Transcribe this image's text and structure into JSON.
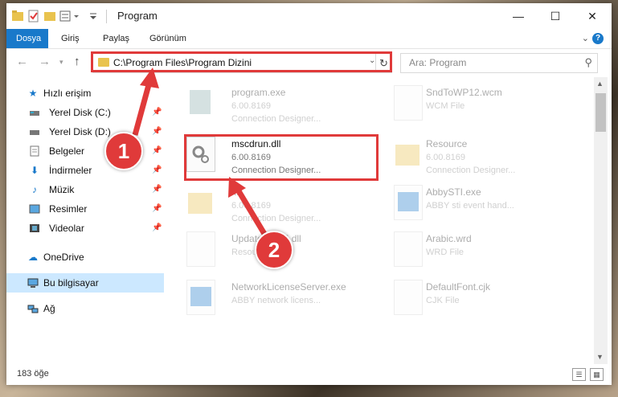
{
  "window": {
    "title": "Program",
    "controls": {
      "minimize": "—",
      "maximize": "☐",
      "close": "✕"
    }
  },
  "ribbon": {
    "tabs": [
      {
        "label": "Dosya",
        "active": true
      },
      {
        "label": "Giriş"
      },
      {
        "label": "Paylaş"
      },
      {
        "label": "Görünüm"
      }
    ],
    "help": "?"
  },
  "nav": {
    "address": "C:\\Program Files\\Program Dizini",
    "search_placeholder": "Ara: Program"
  },
  "sidebar": {
    "items": [
      {
        "label": "Hızlı erişim",
        "icon": "star-icon",
        "pinned": false
      },
      {
        "label": "Yerel Disk (C:)",
        "icon": "drive-icon",
        "pinned": true
      },
      {
        "label": "Yerel Disk (D:)",
        "icon": "drive-icon",
        "pinned": true
      },
      {
        "label": "Belgeler",
        "icon": "documents-icon",
        "pinned": true
      },
      {
        "label": "İndirmeler",
        "icon": "download-icon",
        "pinned": true
      },
      {
        "label": "Müzik",
        "icon": "music-icon",
        "pinned": true
      },
      {
        "label": "Resimler",
        "icon": "pictures-icon",
        "pinned": true
      },
      {
        "label": "Videolar",
        "icon": "video-icon",
        "pinned": true
      },
      {
        "label": "OneDrive",
        "icon": "cloud-icon"
      },
      {
        "label": "Bu bilgisayar",
        "icon": "computer-icon",
        "selected": true
      },
      {
        "label": "Ağ",
        "icon": "network-icon"
      }
    ]
  },
  "files": [
    {
      "name": "program.exe",
      "version": "6.00.8169",
      "desc": "Connection Designer...",
      "dim": true
    },
    {
      "name": "SndToWP12.wcm",
      "version": "WCM File",
      "desc": "",
      "dim": true
    },
    {
      "name": "mscdrun.dll",
      "version": "6.00.8169",
      "desc": "Connection Designer...",
      "dim": false
    },
    {
      "name": "Resource",
      "version": "6.00.8169",
      "desc": "Connection Designer...",
      "dim": true
    },
    {
      "name": "xtr",
      "version": "6.00.8169",
      "desc": "Connection Designer...",
      "dim": true
    },
    {
      "name": "AbbySTI.exe",
      "version": "ABBY sti event hand...",
      "desc": "",
      "dim": true
    },
    {
      "name": "Updatestat65.dll",
      "version": "Resource",
      "desc": "",
      "dim": true
    },
    {
      "name": "Arabic.wrd",
      "version": "WRD File",
      "desc": "",
      "dim": true
    },
    {
      "name": "NetworkLicenseServer.exe",
      "version": "ABBY network licens...",
      "desc": "",
      "dim": true
    },
    {
      "name": "DefaultFont.cjk",
      "version": "CJK File",
      "desc": "",
      "dim": true
    }
  ],
  "status": {
    "count": "183 öğe"
  },
  "callouts": [
    {
      "number": "1"
    },
    {
      "number": "2"
    }
  ],
  "colors": {
    "accent": "#1979ca",
    "highlight": "#e03a3a",
    "folder": "#e9c34e"
  }
}
